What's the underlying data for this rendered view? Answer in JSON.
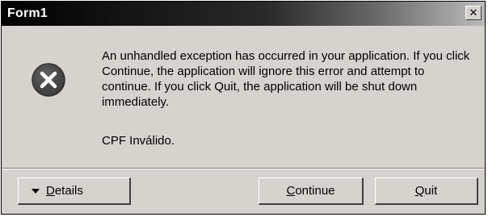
{
  "window": {
    "title": "Form1",
    "close_glyph": "✕"
  },
  "dialog": {
    "icon": "error-icon",
    "message": "An unhandled exception has occurred in your application. If you click Continue, the application will ignore this error and attempt to continue. If you click Quit, the application will be shut down immediately.",
    "detail": "CPF Inválido."
  },
  "buttons": {
    "details": {
      "first": "D",
      "rest": "etails"
    },
    "continue": {
      "first": "C",
      "rest": "ontinue"
    },
    "quit": {
      "first": "Q",
      "rest": "uit"
    }
  },
  "colors": {
    "face": "#d6d3ce",
    "icon_red": "#444444"
  }
}
